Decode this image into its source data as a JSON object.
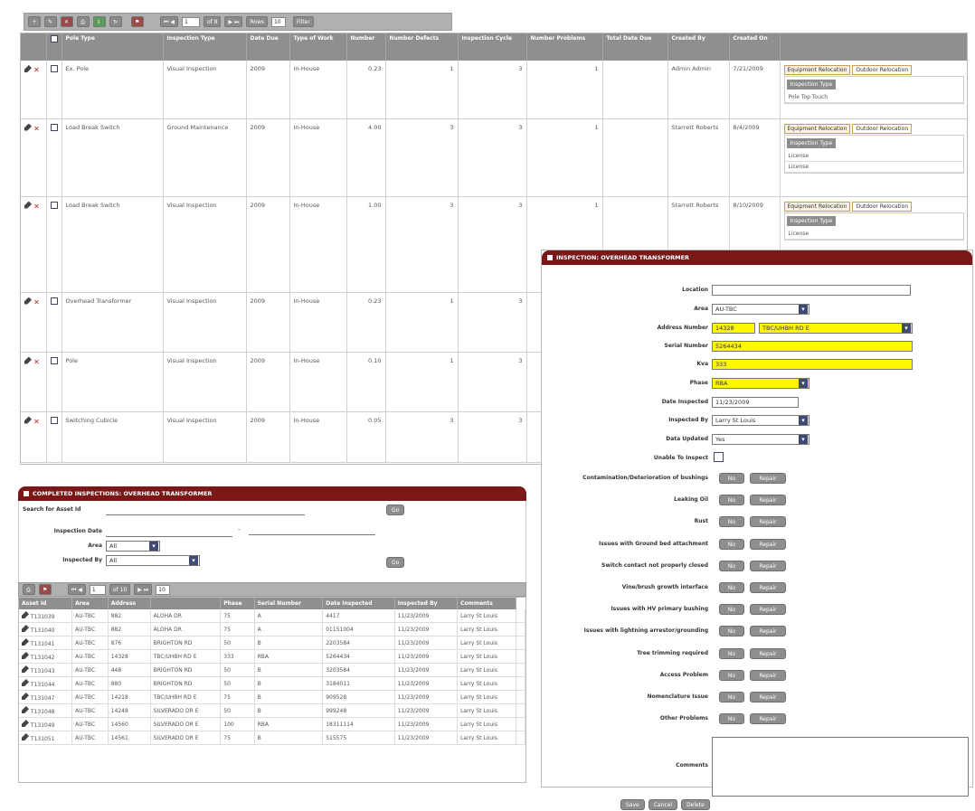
{
  "toolbar": {
    "page_value": "1",
    "page_of": "of 8",
    "rows_label": "Rows",
    "rows_value": "10",
    "btn_labels": [
      "",
      "",
      "",
      "",
      "",
      ""
    ],
    "nav_label": "Next",
    "view_label": "Filter"
  },
  "grid": {
    "headers": [
      "Pole Type",
      "Inspection Type",
      "Date Due",
      "Type of Work",
      "Number",
      "Number Defects",
      "Inspection Cycle",
      "Number Problems",
      "Total Date Due",
      "Created By",
      "Created On"
    ],
    "rows": [
      {
        "pole_type": "Ex. Pole",
        "inspection_type": "Visual Inspection",
        "date_due": "2009",
        "type_of_work": "In-House",
        "number": "0.23",
        "defects": "1",
        "cycle": "3",
        "problems": "1",
        "total": "",
        "created_by": "Admin Admin",
        "created_on": "7/21/2009",
        "tab1": "Equipment Relocation",
        "tab2": "Outdoor Relocation",
        "sub_header": "Inspection Type",
        "sub_rows": [
          "Pole Top Touch"
        ]
      },
      {
        "pole_type": "Load Break Switch",
        "inspection_type": "Ground Maintenance",
        "date_due": "2009",
        "type_of_work": "In-House",
        "number": "4.00",
        "defects": "3",
        "cycle": "3",
        "problems": "1",
        "total": "",
        "created_by": "Starrett Roberts",
        "created_on": "8/4/2009",
        "tab1": "Equipment Relocation",
        "tab2": "Outdoor Relocation",
        "sub_header": "Inspection Type",
        "sub_rows": [
          "License",
          "License"
        ]
      },
      {
        "pole_type": "Load Break Switch",
        "inspection_type": "Visual Inspection",
        "date_due": "2009",
        "type_of_work": "In-House",
        "number": "1.00",
        "defects": "3",
        "cycle": "3",
        "problems": "1",
        "total": "",
        "created_by": "Starrett Roberts",
        "created_on": "8/10/2009",
        "tab1": "Equipment Relocation",
        "tab2": "Outdoor Relocation",
        "sub_header": "Inspection Type",
        "sub_rows": [
          "License"
        ]
      },
      {
        "pole_type": "Overhead Transformer",
        "inspection_type": "Visual Inspection",
        "date_due": "2009",
        "type_of_work": "In-House",
        "number": "0.23",
        "defects": "1",
        "cycle": "3",
        "problems": "",
        "total": "",
        "created_by": "",
        "created_on": "",
        "tab1": "",
        "tab2": "",
        "sub_header": "",
        "sub_rows": []
      },
      {
        "pole_type": "Pole",
        "inspection_type": "Visual Inspection",
        "date_due": "2009",
        "type_of_work": "In-House",
        "number": "0.10",
        "defects": "1",
        "cycle": "3",
        "problems": "",
        "total": "",
        "created_by": "",
        "created_on": "",
        "tab1": "",
        "tab2": "",
        "sub_header": "",
        "sub_rows": []
      },
      {
        "pole_type": "Switching Cubicle",
        "inspection_type": "Visual Inspection",
        "date_due": "2009",
        "type_of_work": "In-House",
        "number": "0.05",
        "defects": "3",
        "cycle": "3",
        "problems": "",
        "total": "",
        "created_by": "",
        "created_on": "",
        "tab1": "",
        "tab2": "",
        "sub_header": "",
        "sub_rows": []
      }
    ]
  },
  "completed": {
    "title": "Completed Inspections: Overhead Transformer",
    "search_label": "Search for Asset Id",
    "date_label": "Inspection Date",
    "date_sep": "-",
    "area_label": "Area",
    "area_value": "All",
    "inspected_label": "Inspected By",
    "inspected_value": "All",
    "go_label": "Go",
    "go2_label": "Go",
    "page_value": "1",
    "page_of": "of 10",
    "rows_value": "10",
    "headers": [
      "Asset Id",
      "Area",
      "Address",
      "",
      "Phase",
      "Serial Number",
      "Date Inspected",
      "Inspected By",
      "Comments"
    ],
    "rows": [
      [
        "T131039",
        "AU-TBC",
        "882",
        "ALOHA DR",
        "75",
        "A",
        "4417",
        "11/23/2009",
        "Larry St Louis"
      ],
      [
        "T131040",
        "AU-TBC",
        "882",
        "ALOHA DR",
        "75",
        "A",
        "01151004",
        "11/23/2009",
        "Larry St Louis"
      ],
      [
        "T131041",
        "AU-TBC",
        "876",
        "BRIGHTON RD",
        "50",
        "B",
        "2203584",
        "11/23/2009",
        "Larry St Louis"
      ],
      [
        "T131042",
        "AU-TBC",
        "14328",
        "TBC/UHBH RD E",
        "333",
        "RBA",
        "5264434",
        "11/23/2009",
        "Larry St Louis"
      ],
      [
        "T131043",
        "AU-TBC",
        "448",
        "BRIGHTON RD",
        "50",
        "B",
        "3203584",
        "11/23/2009",
        "Larry St Louis"
      ],
      [
        "T131044",
        "AU-TBC",
        "880",
        "BRIGHTON RD",
        "50",
        "B",
        "3184011",
        "11/23/2009",
        "Larry St Louis"
      ],
      [
        "T131047",
        "AU-TBC",
        "14218",
        "TBC/UHBH RD E",
        "75",
        "B",
        "909528",
        "11/23/2009",
        "Larry St Louis"
      ],
      [
        "T131048",
        "AU-TBC",
        "14248",
        "SILVERADO DR E",
        "50",
        "B",
        "999248",
        "11/23/2009",
        "Larry St Louis"
      ],
      [
        "T131049",
        "AU-TBC",
        "14560",
        "SILVERADO DR E",
        "100",
        "RBA",
        "18311114",
        "11/23/2009",
        "Larry St Louis"
      ],
      [
        "T131051",
        "AU-TBC",
        "14561",
        "SILVERADO DR E",
        "75",
        "B",
        "515575",
        "11/23/2009",
        "Larry St Louis"
      ]
    ]
  },
  "inspection": {
    "title": "Inspection: Overhead Transformer",
    "location_label": "Location",
    "location_value": "",
    "area_label": "Area",
    "area_value": "AU-TBC",
    "address_label": "Address Number",
    "address_number": "14328",
    "address_street": "TBC/UHBH RD E",
    "serial_label": "Serial Number",
    "serial_value": "5264434",
    "kva_label": "Kva",
    "kva_value": "333",
    "phase_label": "Phase",
    "phase_value": "RBA",
    "date_label": "Date Inspected",
    "date_value": "11/23/2009",
    "inspected_label": "Inspected By",
    "inspected_value": "Larry St Louis",
    "updated_label": "Data Updated",
    "updated_value": "Yes",
    "unable_label": "Unable To Inspect",
    "questions": [
      "Contamination/Deterioration of bushings",
      "Leaking Oil",
      "Rust",
      "Issues with Ground bed attachment",
      "Switch contact not properly closed",
      "Vine/brush growth interface",
      "Issues with HV primary bushing",
      "Issues with lightning arrestor/grounding",
      "Tree trimming required",
      "Access Problem",
      "Nomenclature Issue",
      "Other Problems"
    ],
    "no_label": "No",
    "yes_label": "Repair",
    "comments_label": "Comments"
  },
  "footer": {
    "buttons": [
      "Save",
      "Cancel",
      "Delete"
    ]
  }
}
